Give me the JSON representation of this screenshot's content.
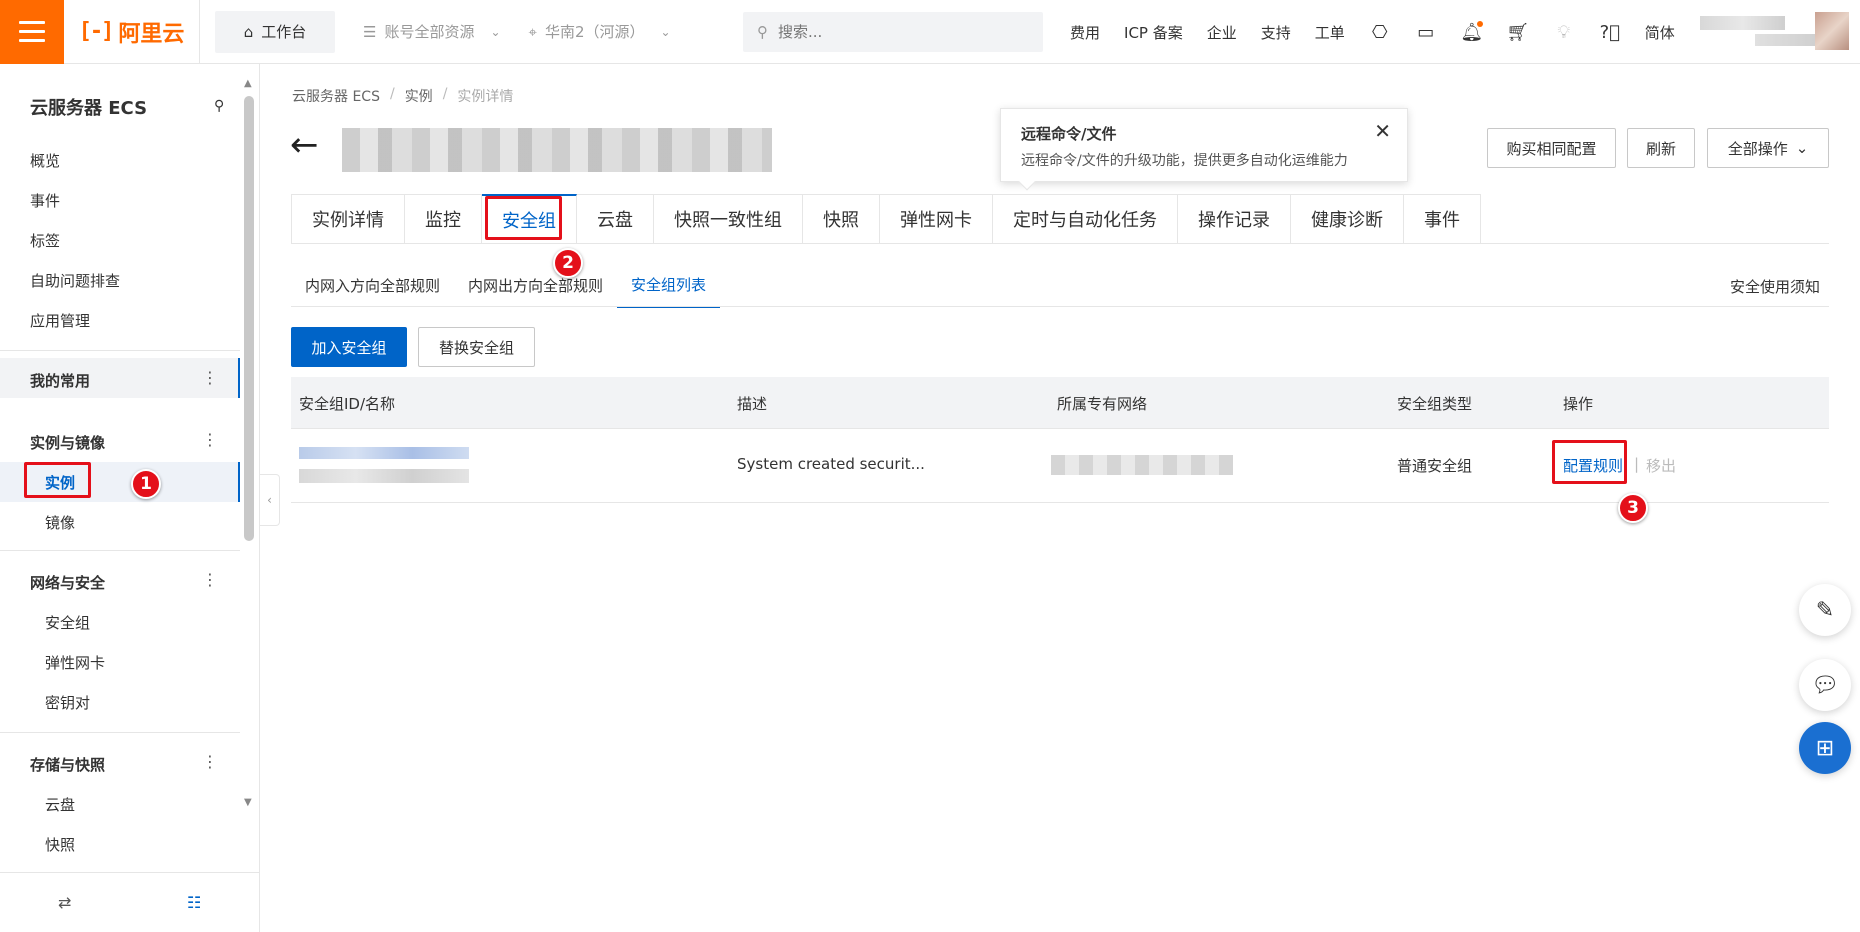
{
  "topbar": {
    "brand": "阿里云",
    "workbench": "工作台",
    "resource_select": "账号全部资源",
    "region_select": "华南2（河源）",
    "search_placeholder": "搜索...",
    "links": [
      "费用",
      "ICP 备案",
      "企业",
      "支持",
      "工单"
    ],
    "lang": "简体"
  },
  "sidebar": {
    "title": "云服务器 ECS",
    "top_items": [
      "概览",
      "事件",
      "标签",
      "自助问题排查",
      "应用管理"
    ],
    "favorites": "我的常用",
    "groups": [
      {
        "label": "实例与镜像",
        "items": [
          "实例",
          "镜像"
        ]
      },
      {
        "label": "网络与安全",
        "items": [
          "安全组",
          "弹性网卡",
          "密钥对"
        ]
      },
      {
        "label": "存储与快照",
        "items": [
          "云盘",
          "快照"
        ]
      }
    ]
  },
  "annotations": {
    "b1": "1",
    "b2": "2",
    "b3": "3"
  },
  "breadcrumb": [
    "云服务器 ECS",
    "实例",
    "实例详情"
  ],
  "tooltip": {
    "title": "远程命令/文件",
    "body": "远程命令/文件的升级功能，提供更多自动化运维能力"
  },
  "header_buttons": {
    "buy_same": "购买相同配置",
    "refresh": "刷新",
    "all_ops": "全部操作"
  },
  "tabs": [
    "实例详情",
    "监控",
    "安全组",
    "云盘",
    "快照一致性组",
    "快照",
    "弹性网卡",
    "定时与自动化任务",
    "操作记录",
    "健康诊断",
    "事件"
  ],
  "subtabs": [
    "内网入方向全部规则",
    "内网出方向全部规则",
    "安全组列表"
  ],
  "notice": "安全使用须知",
  "actions": {
    "join": "加入安全组",
    "replace": "替换安全组"
  },
  "table": {
    "headers": [
      "安全组ID/名称",
      "描述",
      "所属专有网络",
      "安全组类型",
      "操作"
    ],
    "row": {
      "description": "System created securit...",
      "type": "普通安全组",
      "config": "配置规则",
      "sep": "|",
      "remove": "移出"
    }
  },
  "colors": {
    "brand": "#ff6a00",
    "primary": "#0064c8",
    "annotation": "#e4101a"
  }
}
